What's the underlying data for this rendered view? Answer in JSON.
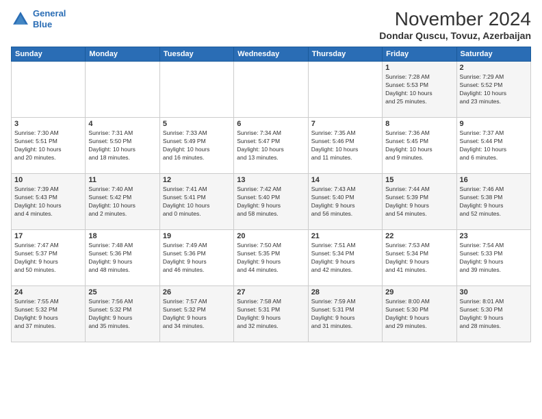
{
  "header": {
    "logo_line1": "General",
    "logo_line2": "Blue",
    "month": "November 2024",
    "location": "Dondar Quscu, Tovuz, Azerbaijan"
  },
  "weekdays": [
    "Sunday",
    "Monday",
    "Tuesday",
    "Wednesday",
    "Thursday",
    "Friday",
    "Saturday"
  ],
  "weeks": [
    [
      {
        "day": "",
        "info": ""
      },
      {
        "day": "",
        "info": ""
      },
      {
        "day": "",
        "info": ""
      },
      {
        "day": "",
        "info": ""
      },
      {
        "day": "",
        "info": ""
      },
      {
        "day": "1",
        "info": "Sunrise: 7:28 AM\nSunset: 5:53 PM\nDaylight: 10 hours\nand 25 minutes."
      },
      {
        "day": "2",
        "info": "Sunrise: 7:29 AM\nSunset: 5:52 PM\nDaylight: 10 hours\nand 23 minutes."
      }
    ],
    [
      {
        "day": "3",
        "info": "Sunrise: 7:30 AM\nSunset: 5:51 PM\nDaylight: 10 hours\nand 20 minutes."
      },
      {
        "day": "4",
        "info": "Sunrise: 7:31 AM\nSunset: 5:50 PM\nDaylight: 10 hours\nand 18 minutes."
      },
      {
        "day": "5",
        "info": "Sunrise: 7:33 AM\nSunset: 5:49 PM\nDaylight: 10 hours\nand 16 minutes."
      },
      {
        "day": "6",
        "info": "Sunrise: 7:34 AM\nSunset: 5:47 PM\nDaylight: 10 hours\nand 13 minutes."
      },
      {
        "day": "7",
        "info": "Sunrise: 7:35 AM\nSunset: 5:46 PM\nDaylight: 10 hours\nand 11 minutes."
      },
      {
        "day": "8",
        "info": "Sunrise: 7:36 AM\nSunset: 5:45 PM\nDaylight: 10 hours\nand 9 minutes."
      },
      {
        "day": "9",
        "info": "Sunrise: 7:37 AM\nSunset: 5:44 PM\nDaylight: 10 hours\nand 6 minutes."
      }
    ],
    [
      {
        "day": "10",
        "info": "Sunrise: 7:39 AM\nSunset: 5:43 PM\nDaylight: 10 hours\nand 4 minutes."
      },
      {
        "day": "11",
        "info": "Sunrise: 7:40 AM\nSunset: 5:42 PM\nDaylight: 10 hours\nand 2 minutes."
      },
      {
        "day": "12",
        "info": "Sunrise: 7:41 AM\nSunset: 5:41 PM\nDaylight: 10 hours\nand 0 minutes."
      },
      {
        "day": "13",
        "info": "Sunrise: 7:42 AM\nSunset: 5:40 PM\nDaylight: 9 hours\nand 58 minutes."
      },
      {
        "day": "14",
        "info": "Sunrise: 7:43 AM\nSunset: 5:40 PM\nDaylight: 9 hours\nand 56 minutes."
      },
      {
        "day": "15",
        "info": "Sunrise: 7:44 AM\nSunset: 5:39 PM\nDaylight: 9 hours\nand 54 minutes."
      },
      {
        "day": "16",
        "info": "Sunrise: 7:46 AM\nSunset: 5:38 PM\nDaylight: 9 hours\nand 52 minutes."
      }
    ],
    [
      {
        "day": "17",
        "info": "Sunrise: 7:47 AM\nSunset: 5:37 PM\nDaylight: 9 hours\nand 50 minutes."
      },
      {
        "day": "18",
        "info": "Sunrise: 7:48 AM\nSunset: 5:36 PM\nDaylight: 9 hours\nand 48 minutes."
      },
      {
        "day": "19",
        "info": "Sunrise: 7:49 AM\nSunset: 5:36 PM\nDaylight: 9 hours\nand 46 minutes."
      },
      {
        "day": "20",
        "info": "Sunrise: 7:50 AM\nSunset: 5:35 PM\nDaylight: 9 hours\nand 44 minutes."
      },
      {
        "day": "21",
        "info": "Sunrise: 7:51 AM\nSunset: 5:34 PM\nDaylight: 9 hours\nand 42 minutes."
      },
      {
        "day": "22",
        "info": "Sunrise: 7:53 AM\nSunset: 5:34 PM\nDaylight: 9 hours\nand 41 minutes."
      },
      {
        "day": "23",
        "info": "Sunrise: 7:54 AM\nSunset: 5:33 PM\nDaylight: 9 hours\nand 39 minutes."
      }
    ],
    [
      {
        "day": "24",
        "info": "Sunrise: 7:55 AM\nSunset: 5:32 PM\nDaylight: 9 hours\nand 37 minutes."
      },
      {
        "day": "25",
        "info": "Sunrise: 7:56 AM\nSunset: 5:32 PM\nDaylight: 9 hours\nand 35 minutes."
      },
      {
        "day": "26",
        "info": "Sunrise: 7:57 AM\nSunset: 5:32 PM\nDaylight: 9 hours\nand 34 minutes."
      },
      {
        "day": "27",
        "info": "Sunrise: 7:58 AM\nSunset: 5:31 PM\nDaylight: 9 hours\nand 32 minutes."
      },
      {
        "day": "28",
        "info": "Sunrise: 7:59 AM\nSunset: 5:31 PM\nDaylight: 9 hours\nand 31 minutes."
      },
      {
        "day": "29",
        "info": "Sunrise: 8:00 AM\nSunset: 5:30 PM\nDaylight: 9 hours\nand 29 minutes."
      },
      {
        "day": "30",
        "info": "Sunrise: 8:01 AM\nSunset: 5:30 PM\nDaylight: 9 hours\nand 28 minutes."
      }
    ]
  ]
}
